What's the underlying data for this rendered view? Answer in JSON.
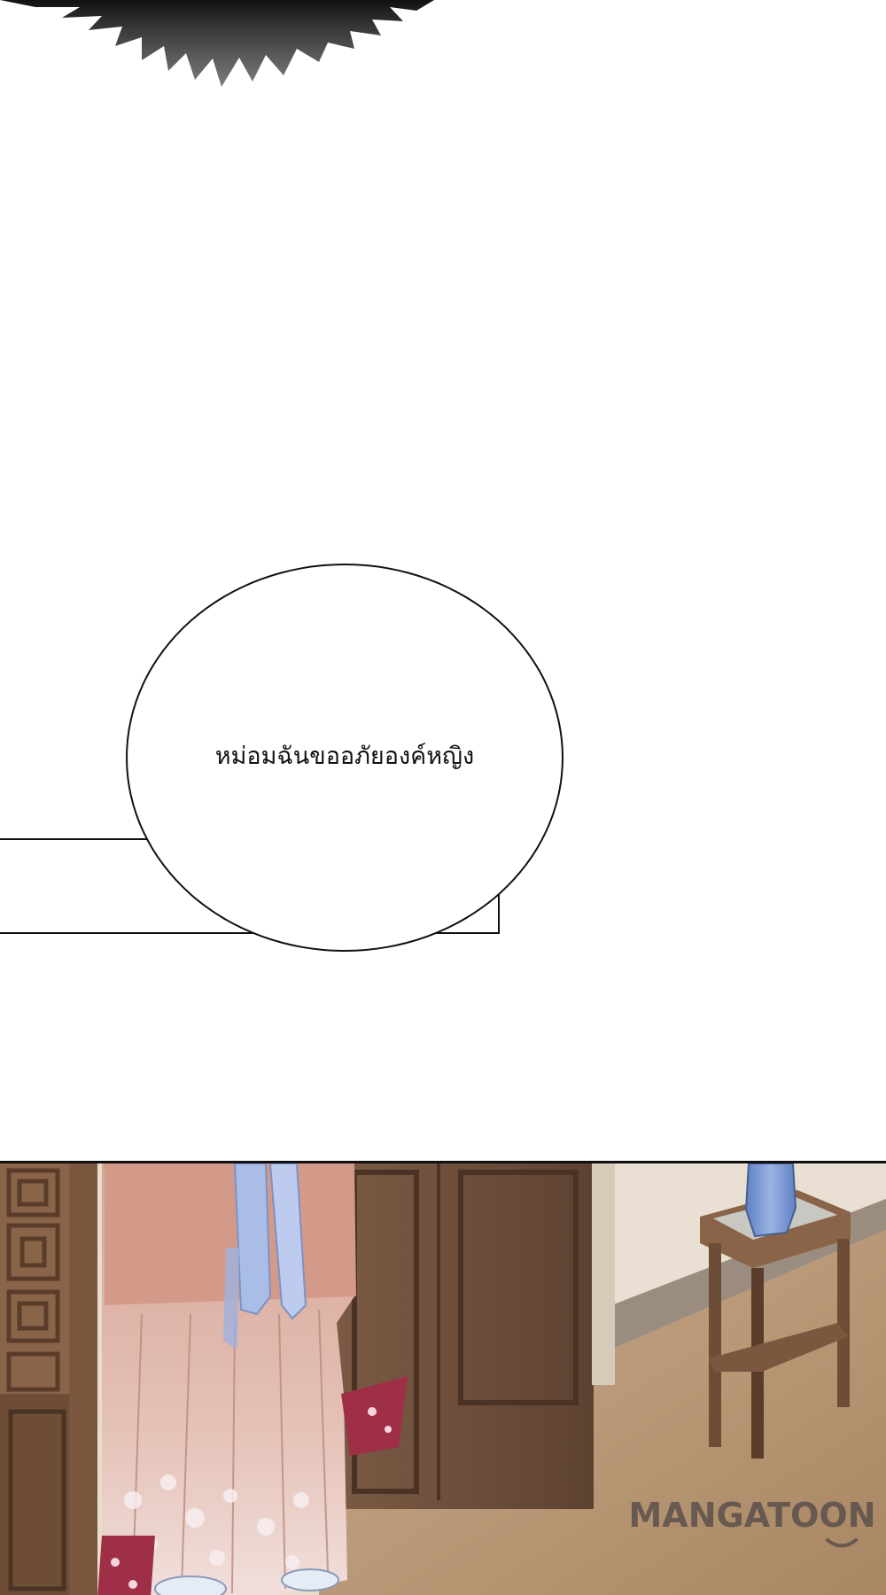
{
  "speech_bubble": {
    "text": "หม่อมฉันขออภัยองค์หญิง"
  },
  "watermark": {
    "text": "MANGATOON"
  },
  "colors": {
    "background": "#ffffff",
    "ink": "#111111",
    "robe_pink": "#d9a79a",
    "sash_blue": "#a9bde6",
    "wood_dark": "#6b4a36",
    "floor": "#b89a78",
    "vase_blue": "#6f8fcf"
  }
}
